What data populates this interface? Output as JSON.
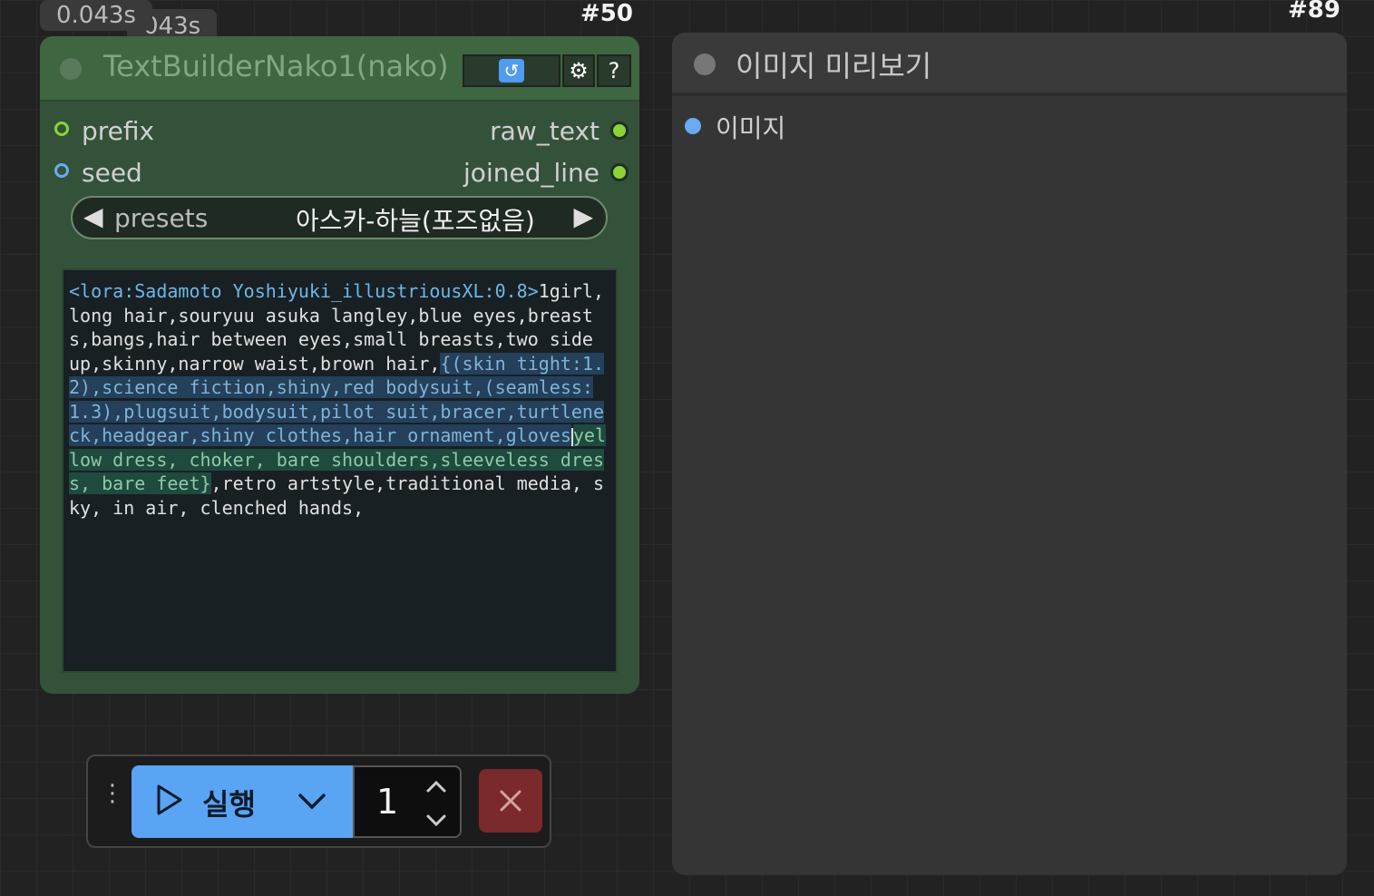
{
  "timing": {
    "front": "0.043s",
    "back": "043s"
  },
  "node_ids": {
    "text_builder": "#50",
    "preview": "#89"
  },
  "text_builder": {
    "title": "TextBuilderNako1(nako)",
    "inputs": [
      {
        "label": "prefix",
        "color": "#8ed23a"
      },
      {
        "label": "seed",
        "color": "#6aaaf0"
      }
    ],
    "outputs": [
      {
        "label": "raw_text"
      },
      {
        "label": "joined_line"
      }
    ],
    "presets": {
      "label": "presets",
      "value": "아스카-하늘(포즈없음)"
    },
    "text": {
      "lora": "<lora:Sadamoto Yoshiyuki_illustriousXL:0.8>",
      "part1": "1girl,long hair,souryuu asuka langley,blue eyes,breasts,bangs,hair between eyes,small breasts,two side up,skinny,narrow waist,brown hair,",
      "hl1": "{(skin tight:1.2),science fiction,shiny,red bodysuit,(seamless:1.3),plugsuit,bodysuit,pilot suit,bracer,turtleneck,headgear,shiny clothes,hair ornament,gloves",
      "hl2": "yellow dress, choker, bare shoulders,sleeveless dress, bare feet}",
      "part2": ",retro artstyle,traditional media, sky, in air, clenched hands,"
    }
  },
  "preview": {
    "title": "이미지 미리보기",
    "input_label": "이미지"
  },
  "runbar": {
    "run_label": "실행",
    "quantity": "1"
  }
}
